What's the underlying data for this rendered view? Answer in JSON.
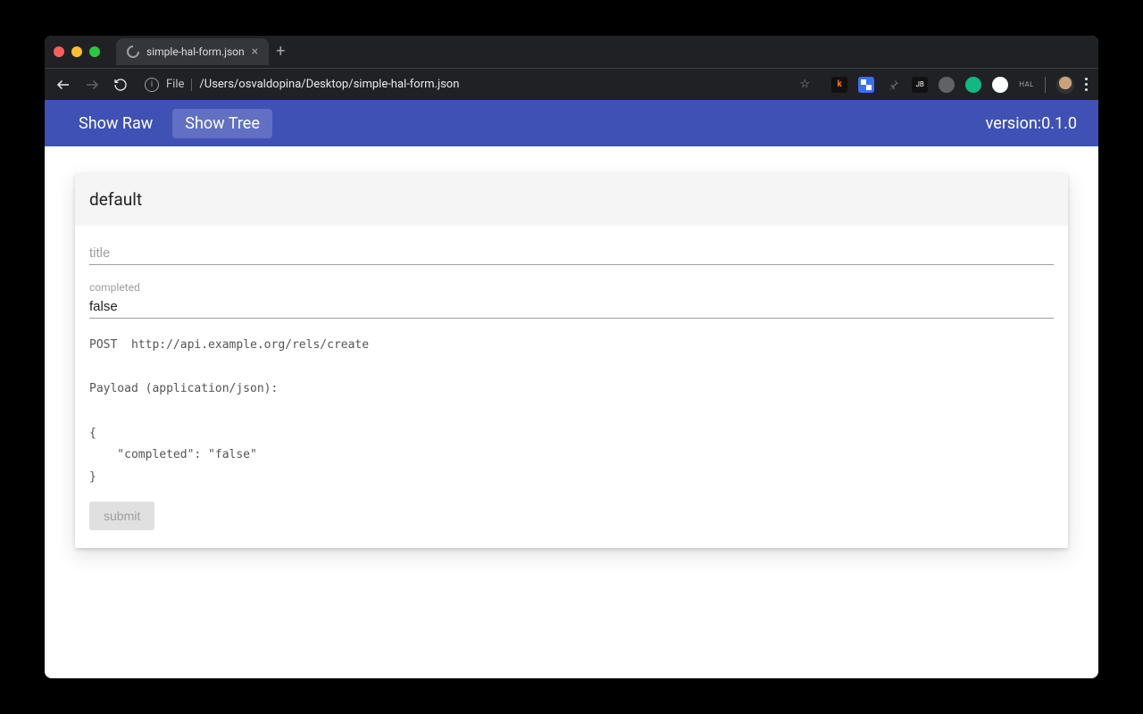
{
  "browser": {
    "tab_title": "simple-hal-form.json",
    "address_scheme": "File",
    "address_path": "/Users/osvaldopina/Desktop/simple-hal-form.json",
    "ext_hal": "HAL"
  },
  "appbar": {
    "show_raw": "Show Raw",
    "show_tree": "Show Tree",
    "version": "version:0.1.0"
  },
  "card": {
    "title": "default",
    "fields": {
      "title": {
        "label": "title",
        "value": ""
      },
      "completed": {
        "label": "completed",
        "value": "false"
      }
    },
    "request": {
      "method": "POST",
      "url": "http://api.example.org/rels/create",
      "payload_label": "Payload (application/json):",
      "payload_body": "{\n    \"completed\": \"false\"\n}"
    },
    "submit_label": "submit"
  }
}
